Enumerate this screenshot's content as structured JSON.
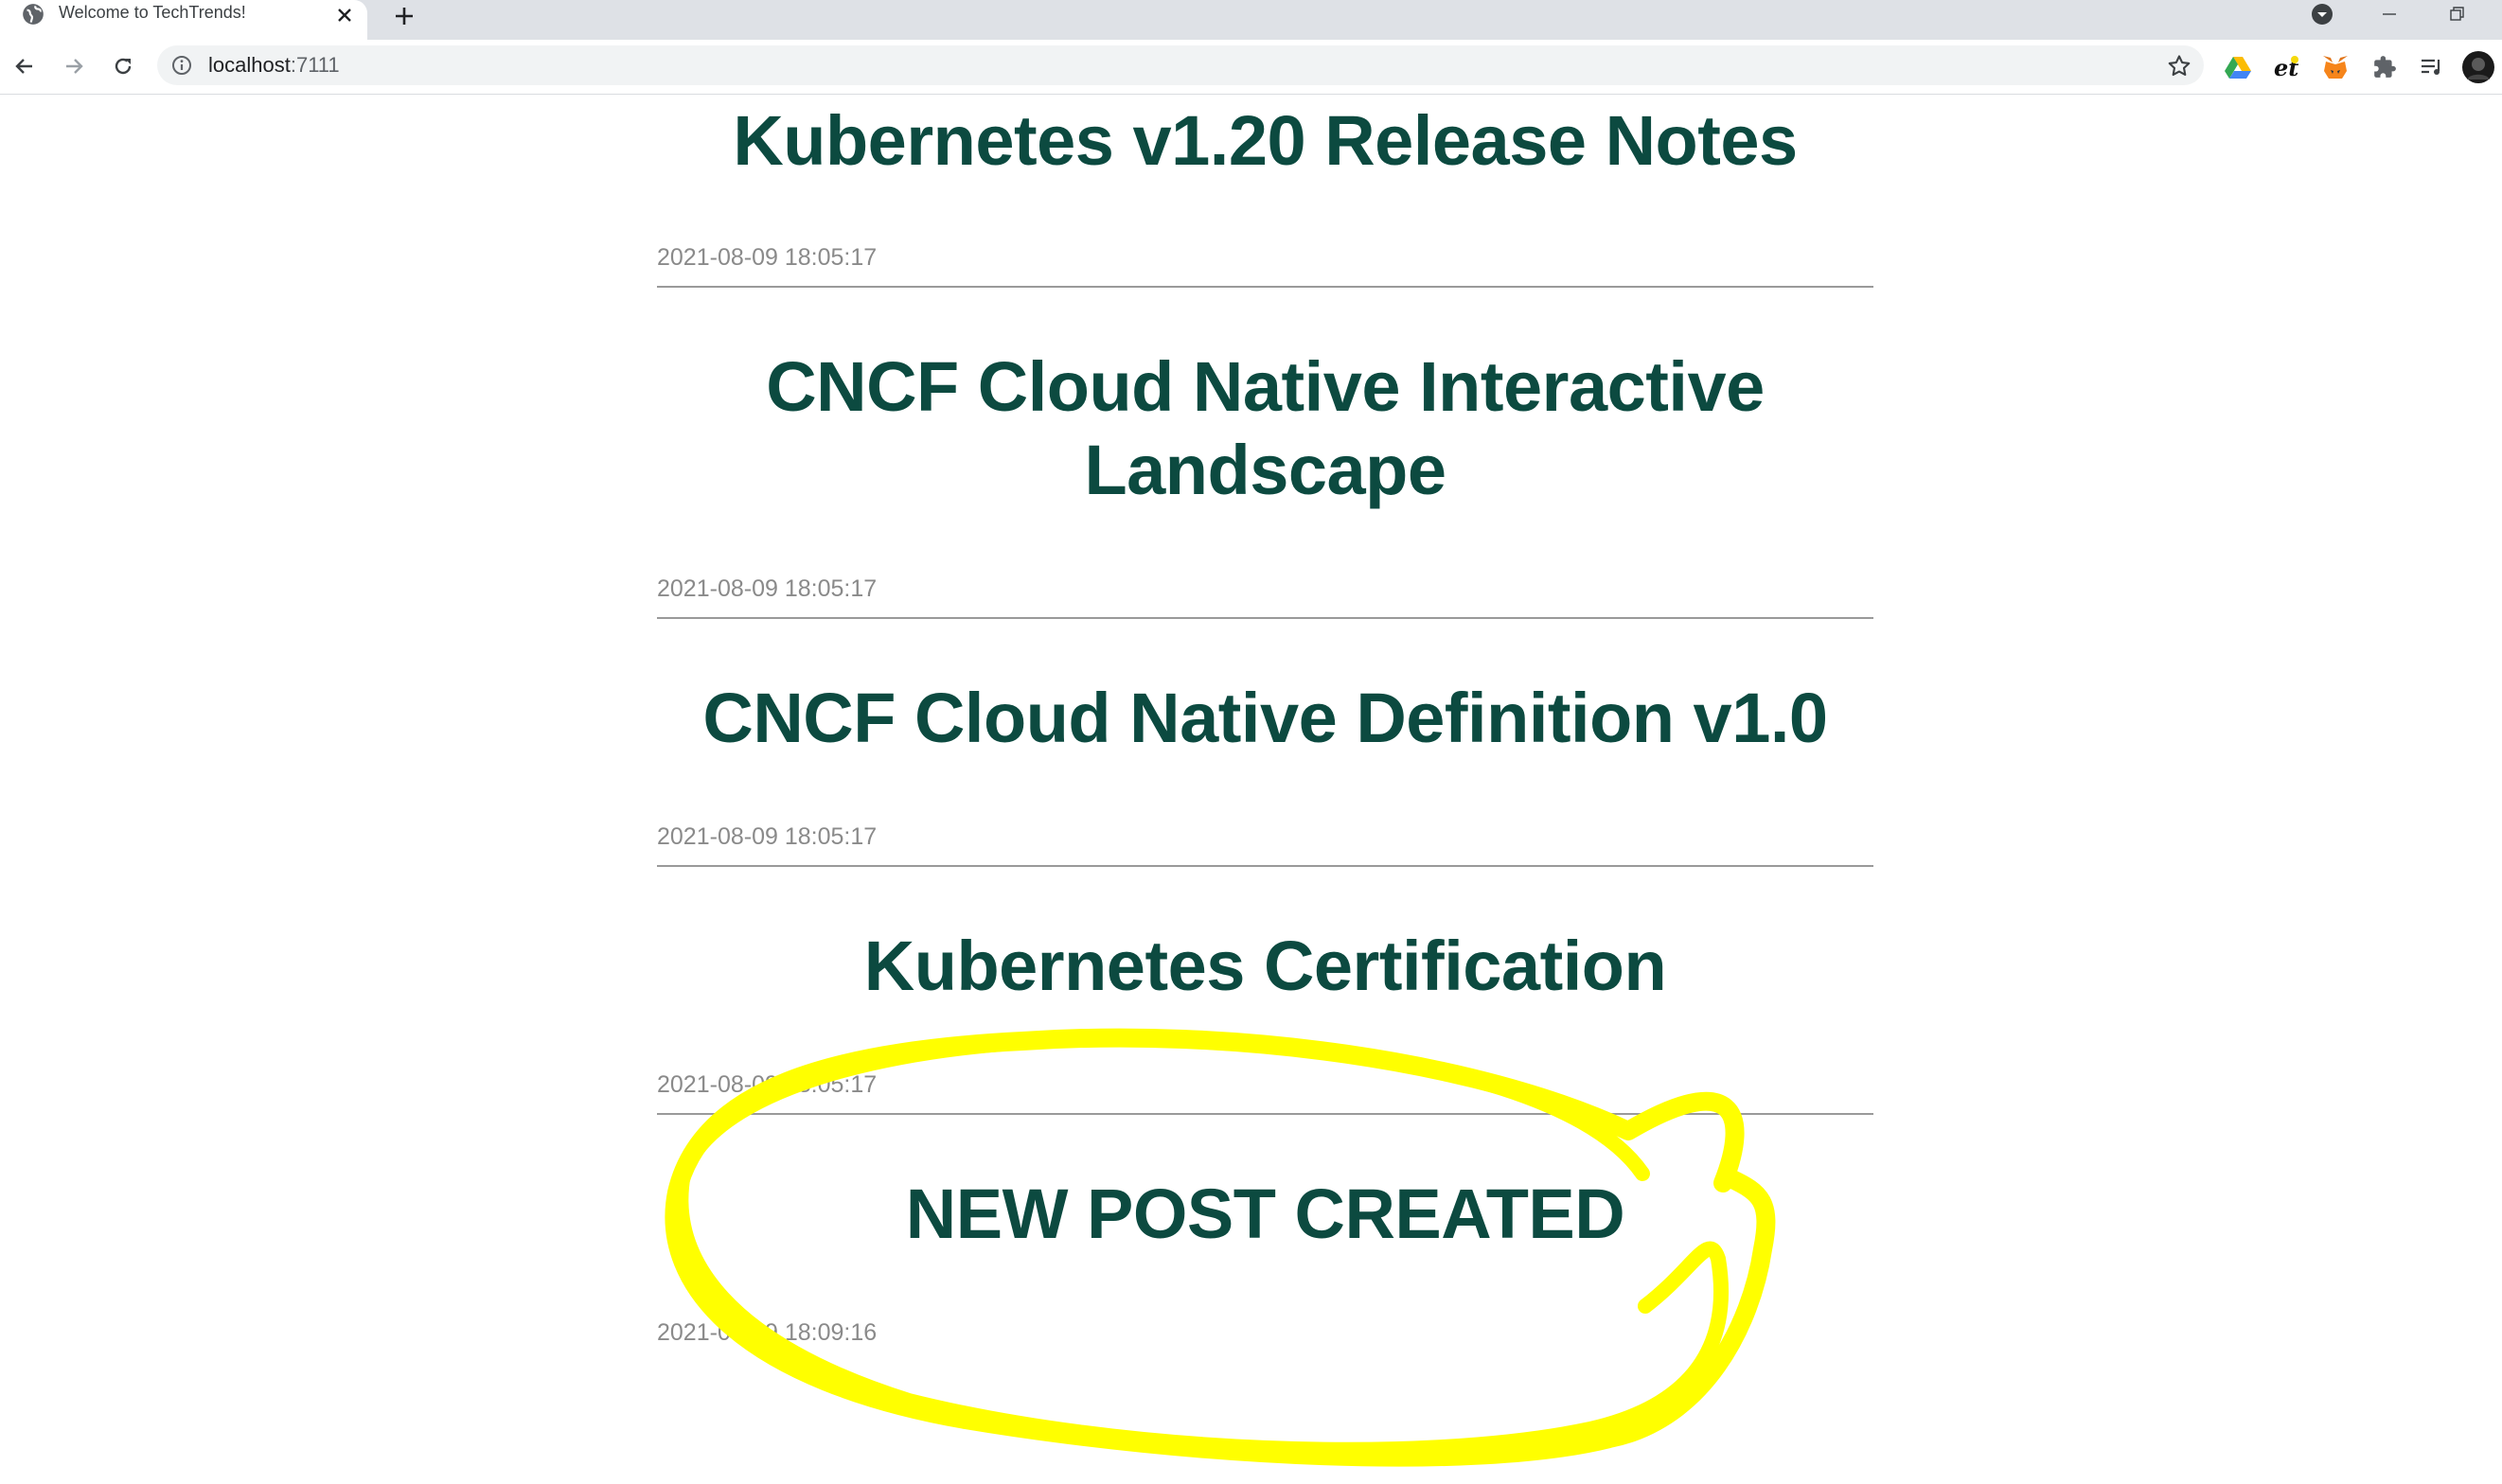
{
  "browser": {
    "tab": {
      "title": "Welcome to TechTrends!",
      "favicon": "globe-icon"
    },
    "address_bar": {
      "host": "localhost",
      "port": ":7111",
      "info_icon": "info-icon"
    },
    "extensions": [
      "google-drive-icon",
      "et-extension-icon",
      "metamask-fox-icon",
      "puzzle-extensions-icon",
      "reading-list-icon",
      "profile-avatar"
    ]
  },
  "posts": [
    {
      "title": "Kubernetes v1.20 Release Notes",
      "created": "2021-08-09 18:05:17"
    },
    {
      "title_line1": "CNCF Cloud Native Interactive",
      "title_line2": "Landscape",
      "created": "2021-08-09 18:05:17"
    },
    {
      "title": "CNCF Cloud Native Definition v1.0",
      "created": "2021-08-09 18:05:17"
    },
    {
      "title": "Kubernetes Certification",
      "created": "2021-08-09 18:05:17"
    },
    {
      "title": "NEW POST CREATED",
      "created": "2021-08-09 18:09:16"
    }
  ],
  "annotation": {
    "type": "hand-drawn circle",
    "color": "#ffff00",
    "encircles": "NEW POST CREATED"
  }
}
